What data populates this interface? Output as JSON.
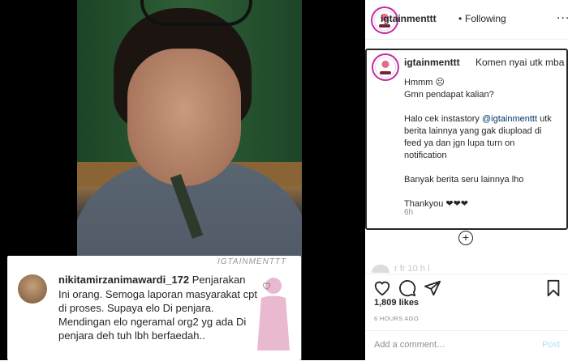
{
  "header": {
    "username": "igtainmenttt",
    "separator": "•",
    "follow_status": "Following",
    "more": "..."
  },
  "caption": {
    "username": "igtainmenttt",
    "first_line": "Komen nyai utk mba You",
    "line1": "Hmmm ☹",
    "line2": "Gmn pendapat kalian?",
    "para2_before": "Halo cek instastory ",
    "mention": "@igtainmenttt",
    "para2_after": " utk berita lainnya yang gak diupload di feed ya dan jgn lupa turn on notification",
    "para3": "Banyak berita seru lainnya lho",
    "para4": "Thankyou ❤❤❤",
    "time": "6h"
  },
  "load_more": "+",
  "partial_comment": "r   fr   10   h   l",
  "actions": {
    "like_icon": "heart-icon",
    "comment_icon": "comment-icon",
    "share_icon": "share-icon",
    "save_icon": "bookmark-icon",
    "likes": "1,809 likes",
    "ago": "6 HOURS AGO"
  },
  "add_comment": {
    "placeholder": "Add a comment…",
    "post_label": "Post"
  },
  "media_overlay": {
    "username": "nikitamirzanimawardi_172",
    "first_word": "Penjarakan",
    "text": "Ini orang. Semoga laporan masyarakat cpt di proses. Supaya elo Di penjara. Mendingan elo ngeramal org2 yg ada Di penjara deh tuh lbh berfaedah..",
    "watermark": "IGTAINMENTTT"
  },
  "colors": {
    "accent": "#0095f6",
    "ring": "#c32aa3",
    "text": "#262626",
    "muted": "#8e8e8e"
  }
}
